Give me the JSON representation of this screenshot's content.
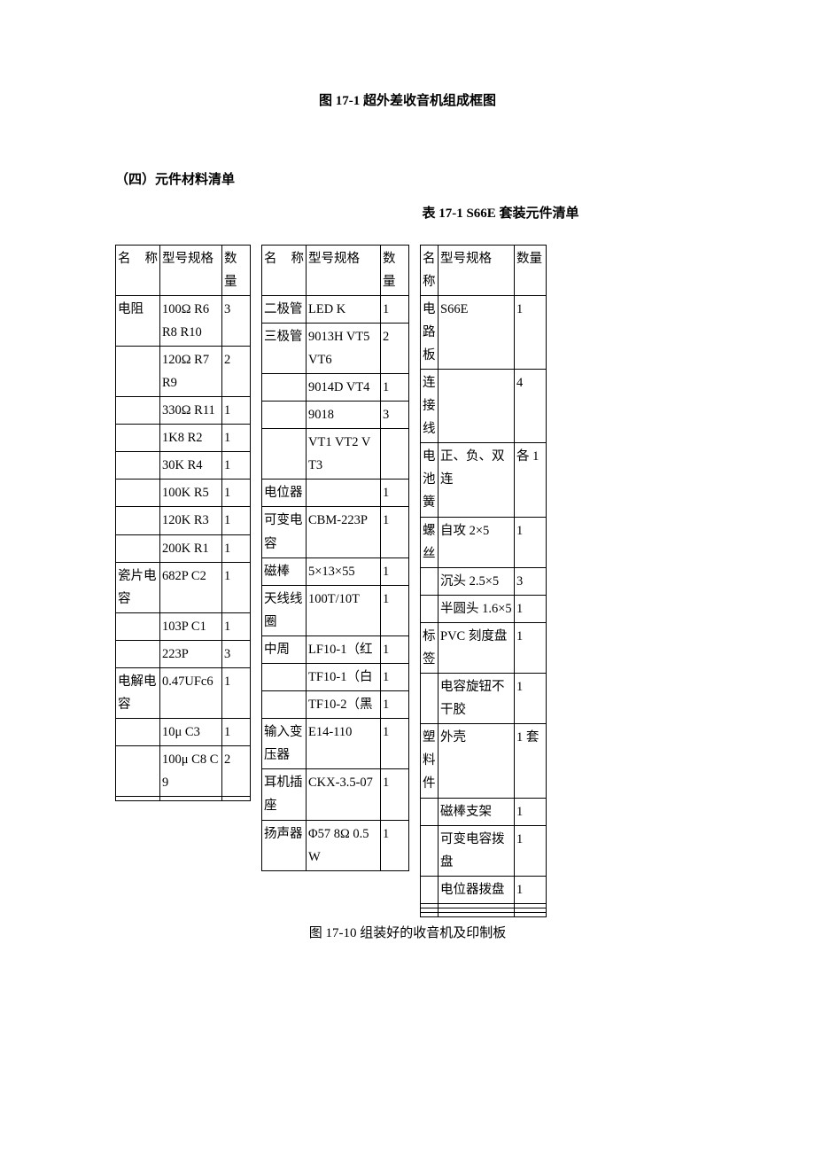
{
  "figure_caption_top": "图 17-1  超外差收音机组成框图",
  "section_heading": "（四）元件材料清单",
  "table_title": "表 17-1 S66E 套装元件清单",
  "headers": {
    "name": "名   称",
    "name_short": "名称",
    "spec": "型号规格",
    "qty": "数量"
  },
  "t1": {
    "rows": [
      {
        "name": "电阻",
        "spec": "100Ω  R6 R8 R10",
        "qty": "3"
      },
      {
        "name": "",
        "spec": "120Ω  R7 R9",
        "qty": "2"
      },
      {
        "name": "",
        "spec": "330Ω  R11",
        "qty": "1"
      },
      {
        "name": "",
        "spec": "1K8 R2",
        "qty": "1"
      },
      {
        "name": "",
        "spec": "30K R4",
        "qty": "1"
      },
      {
        "name": "",
        "spec": "100K R5",
        "qty": "1"
      },
      {
        "name": "",
        "spec": "120K R3",
        "qty": "1"
      },
      {
        "name": "",
        "spec": "200K  R1",
        "qty": "1"
      },
      {
        "name": "瓷片电容",
        "spec": "682P  C2",
        "qty": "1"
      },
      {
        "name": "",
        "spec": "103P C1",
        "qty": "1"
      },
      {
        "name": "",
        "spec": "223P",
        "qty": "3"
      },
      {
        "name": "电解电容",
        "spec": "0.47UFc6",
        "qty": "1"
      },
      {
        "name": "",
        "spec": "10μ  C3",
        "qty": "1"
      },
      {
        "name": "",
        "spec": "100μ  C8 C9",
        "qty": "2"
      },
      {
        "name": "",
        "spec": "",
        "qty": ""
      }
    ]
  },
  "t2": {
    "rows": [
      {
        "name": "二极管",
        "spec": "LED K",
        "qty": "1"
      },
      {
        "name": "三极管",
        "spec": "9013H  VT5 VT6",
        "qty": "2"
      },
      {
        "name": "",
        "spec": "9014D  VT4",
        "qty": "1"
      },
      {
        "name": "",
        "spec": "9018",
        "qty": "3"
      },
      {
        "name": "",
        "spec": "VT1 VT2 VT3",
        "qty": ""
      },
      {
        "name": "电位器",
        "spec": "",
        "qty": "1"
      },
      {
        "name": "可变电容",
        "spec": "CBM-223P",
        "qty": "1"
      },
      {
        "name": "磁棒",
        "spec": "5×13×55",
        "qty": "1"
      },
      {
        "name": "天线线圈",
        "spec": "100T/10T",
        "qty": "1"
      },
      {
        "name": "中周",
        "spec": "LF10-1（红",
        "qty": "1"
      },
      {
        "name": "",
        "spec": "TF10-1（白",
        "qty": "1"
      },
      {
        "name": "",
        "spec": "TF10-2（黑",
        "qty": "1"
      },
      {
        "name": "输入变压器",
        "spec": "E14-110",
        "qty": "1"
      },
      {
        "name": "耳机插座",
        "spec": "CKX-3.5-07",
        "qty": "1"
      },
      {
        "name": "扬声器",
        "spec": "Φ57  8Ω 0.5W",
        "qty": "1"
      }
    ]
  },
  "t3": {
    "rows": [
      {
        "name": "电路板",
        "spec": "S66E",
        "qty": "1"
      },
      {
        "name": "连接线",
        "spec": "",
        "qty": "4"
      },
      {
        "name": "电池簧",
        "spec": "正、负、双连",
        "qty": "各 1"
      },
      {
        "name": "螺丝",
        "spec": "自攻 2×5",
        "qty": "1"
      },
      {
        "name": "",
        "spec": "沉头 2.5×5",
        "qty": "3"
      },
      {
        "name": "",
        "spec": "半圆头 1.6×5",
        "qty": "1"
      },
      {
        "name": "标签",
        "spec": "PVC 刻度盘",
        "qty": "1"
      },
      {
        "name": "",
        "spec": "电容旋钮不干胶",
        "qty": "1"
      },
      {
        "name": "塑料件",
        "spec": "外壳",
        "qty": "1 套"
      },
      {
        "name": "",
        "spec": "磁棒支架",
        "qty": "1"
      },
      {
        "name": "",
        "spec": "可变电容拨盘",
        "qty": "1"
      },
      {
        "name": "",
        "spec": "电位器拨盘",
        "qty": "1"
      },
      {
        "name": "",
        "spec": "",
        "qty": ""
      },
      {
        "name": "",
        "spec": "",
        "qty": ""
      },
      {
        "name": "",
        "spec": "",
        "qty": ""
      }
    ]
  },
  "figure_caption_bottom": "图 17-10 组装好的收音机及印制板"
}
